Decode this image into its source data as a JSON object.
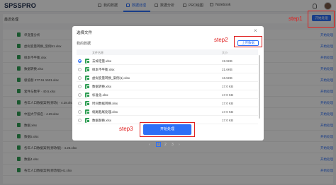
{
  "app": {
    "logo": "SPSSPRO"
  },
  "nav": {
    "items": [
      {
        "label": "我的数据"
      },
      {
        "label": "数据处理"
      },
      {
        "label": "数据分析"
      },
      {
        "label": "PRO绘图"
      },
      {
        "label": "Notebook"
      }
    ]
  },
  "background": {
    "panel_title": "最近处理",
    "top_button": "开始处理",
    "rows": [
      {
        "name": "单变量分析",
        "action": "开始处理"
      },
      {
        "name": "虚拟变量转换_案例51.xlsx",
        "action": "开始处理"
      },
      {
        "name": "样本不平衡.xlsx",
        "action": "开始处理"
      },
      {
        "name": "数据转换.xlsx",
        "action": "开始处理"
      },
      {
        "name": "极值替 277.51 1521.xlsx",
        "action": "开始处理"
      },
      {
        "name": "套件与数字 · 40.5.xlsx",
        "action": "开始处理"
      },
      {
        "name": "各年人口数据案例(修改) · 4.28.xlsx",
        "action": "开始处理"
      },
      {
        "name": "中国大学排名 - 4.29.xlsx",
        "action": "开始处理"
      },
      {
        "name": "数据.xlsx",
        "action": "开始处理"
      },
      {
        "name": "数据5.xlsx",
        "action": "开始处理"
      },
      {
        "name": "各年人口数据案例(修改版) · 4.26.xlsx",
        "action": "开始处理"
      },
      {
        "name": "数据4.xlsx",
        "action": "开始处理"
      },
      {
        "name": "各年人口数据案例(修改版)H1.xlsx",
        "action": "开始处理"
      }
    ]
  },
  "modal": {
    "title": "选择文件",
    "close_glyph": "×",
    "section_label": "我的数据",
    "upload_label": "上传数据",
    "columns": {
      "name": "文件名称",
      "size": "大小"
    },
    "files": [
      {
        "name": "去掉定量.xlsx",
        "size": "19.9KB",
        "selected": true
      },
      {
        "name": "样本不平衡.xlsx",
        "size": "21.6KB",
        "selected": false
      },
      {
        "name": "虚拟变量转换_案例(1).xlsx",
        "size": "16.5KB",
        "selected": false
      },
      {
        "name": "数据转换.xlsx",
        "size": "17.0 KB",
        "selected": false
      },
      {
        "name": "标准化.xlsx",
        "size": "17.0 KB",
        "selected": false
      },
      {
        "name": "时间数据转换.xlsx",
        "size": "17.0 KB",
        "selected": false
      },
      {
        "name": "缩尾截尾处理.xlsx",
        "size": "17.0 KB",
        "selected": false
      },
      {
        "name": "数据替换.xlsx",
        "size": "17.0 KB",
        "selected": false
      }
    ],
    "start_button": "开始处理"
  },
  "pagination": {
    "prev": "‹",
    "pages": [
      "1",
      "2",
      "3"
    ],
    "next": "›",
    "current": "1"
  },
  "annotations": {
    "step1": "step1",
    "step2": "step2",
    "step3": "step3"
  },
  "colors": {
    "accent": "#2d6ff7",
    "annotation": "#e02020",
    "file_icon": "#2f9e54"
  }
}
